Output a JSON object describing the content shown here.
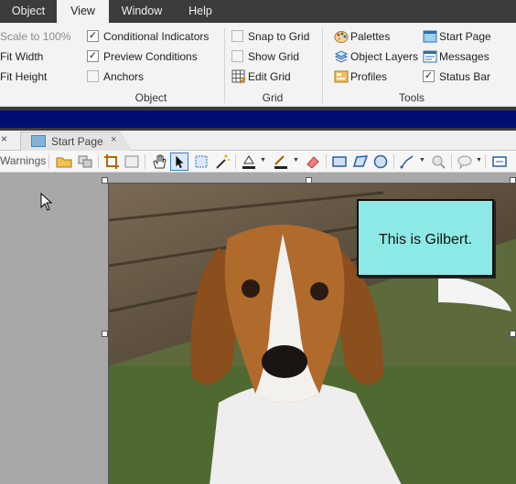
{
  "menu": {
    "items": [
      "Object",
      "View",
      "Window",
      "Help"
    ],
    "active": "View"
  },
  "ribbon": {
    "object_group": {
      "label": "Object",
      "scale_to_100": "Scale to 100%",
      "fit_width": "Fit Width",
      "fit_height": "Fit Height",
      "conditional_indicators": "Conditional Indicators",
      "preview_conditions": "Preview Conditions",
      "anchors": "Anchors"
    },
    "grid_group": {
      "label": "Grid",
      "snap_to_grid": "Snap to Grid",
      "show_grid": "Show Grid",
      "edit_grid": "Edit Grid"
    },
    "tools_group": {
      "label": "Tools",
      "palettes": "Palettes",
      "object_layers": "Object Layers",
      "profiles": "Profiles",
      "start_page": "Start Page",
      "messages": "Messages",
      "status_bar": "Status Bar"
    },
    "check_mark": "✓"
  },
  "tabs": {
    "start_page": "Start Page",
    "close_glyph": "×"
  },
  "toolbar": {
    "warnings": "Warnings"
  },
  "canvas": {
    "callout_text": "This is Gilbert."
  },
  "colors": {
    "menu_bg": "#3c3c3c",
    "ribbon_bg": "#f3f3f3",
    "navy_band": "#000e73",
    "callout_fill": "#8ce9e6"
  },
  "icons": [
    "palette-icon",
    "layers-icon",
    "profiles-icon",
    "start-page-icon",
    "messages-icon",
    "edit-grid-icon",
    "pointer-cursor-icon"
  ]
}
